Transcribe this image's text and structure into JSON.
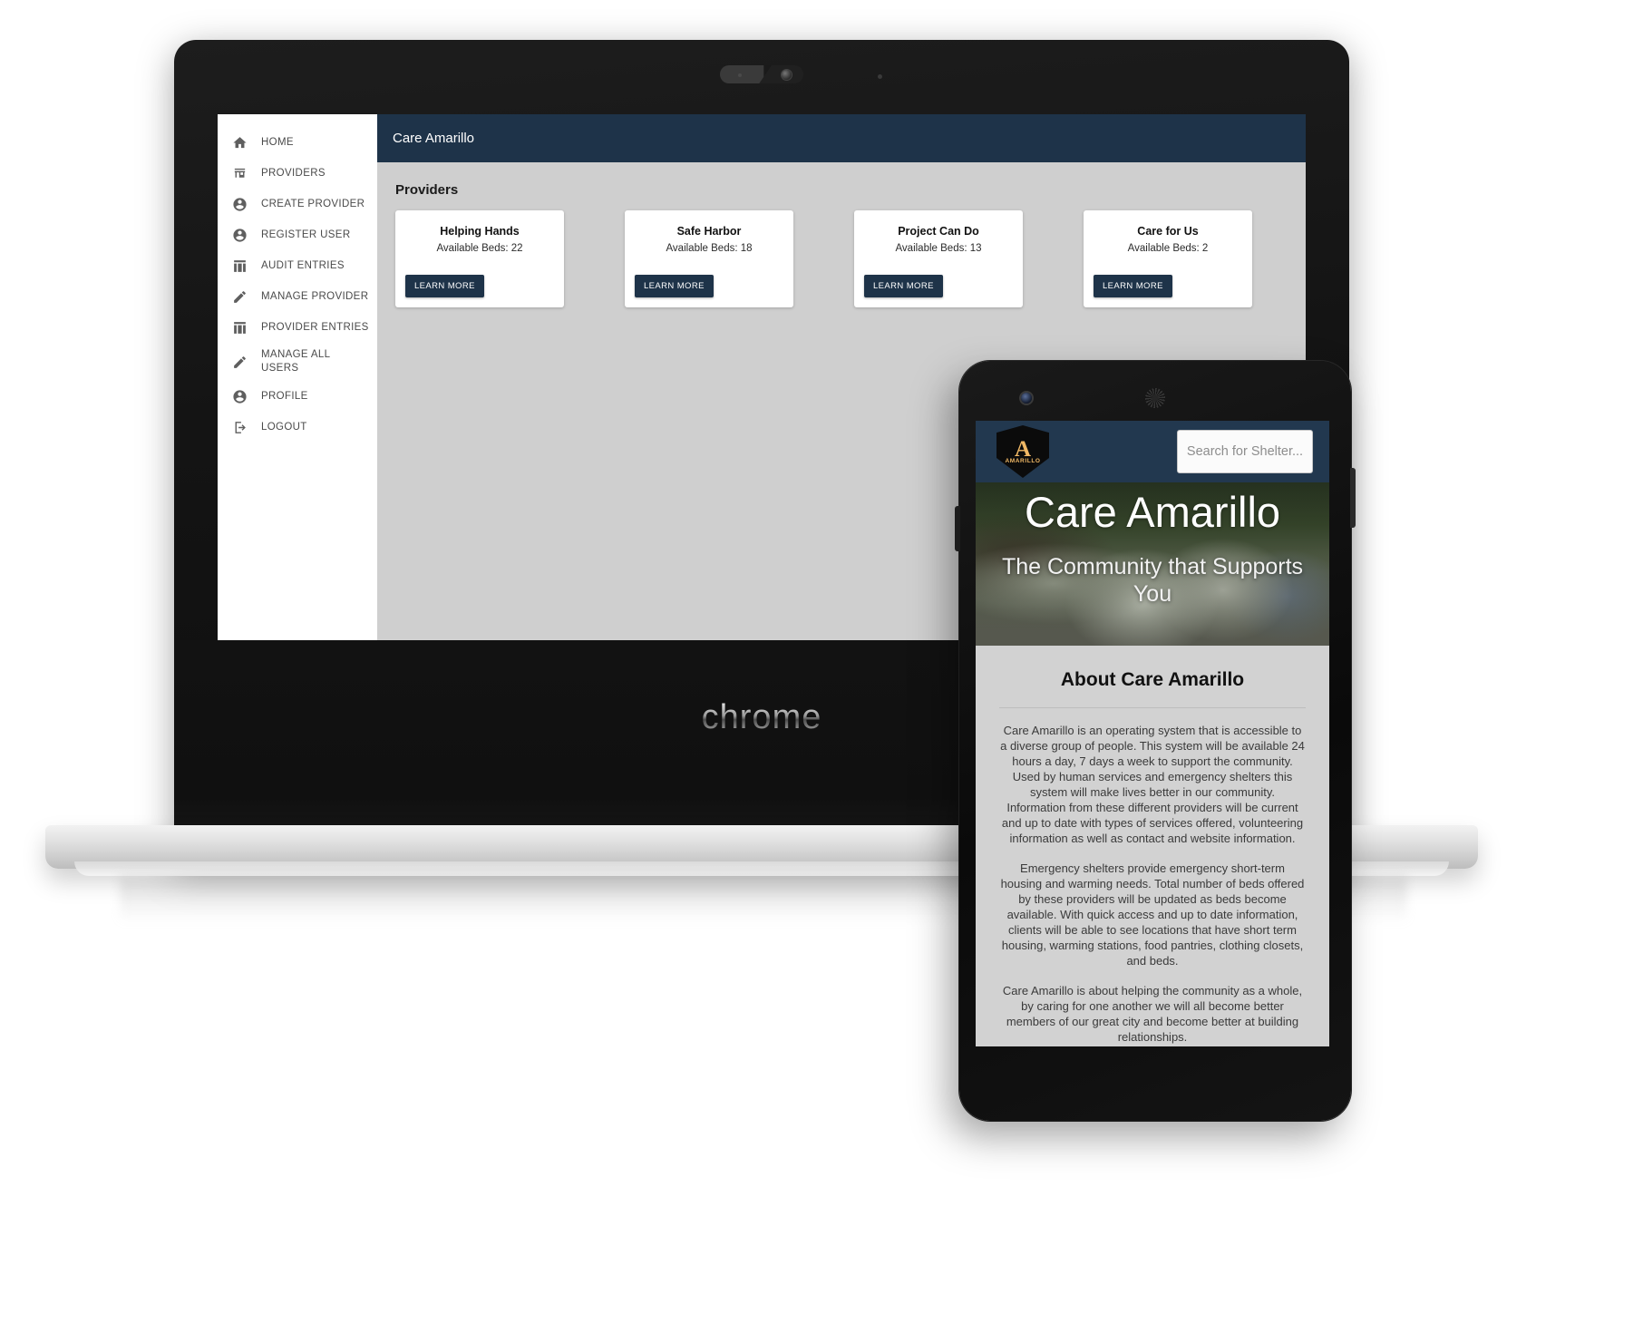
{
  "laptop": {
    "brand_label": "chrome",
    "app": {
      "topbar_title": "Care Amarillo",
      "section_title": "Providers",
      "sidebar_items": [
        {
          "label": "HOME",
          "icon": "home-icon"
        },
        {
          "label": "PROVIDERS",
          "icon": "store-icon"
        },
        {
          "label": "CREATE PROVIDER",
          "icon": "account-circle-icon"
        },
        {
          "label": "REGISTER USER",
          "icon": "account-circle-icon"
        },
        {
          "label": "AUDIT ENTRIES",
          "icon": "table-icon"
        },
        {
          "label": "MANAGE PROVIDER",
          "icon": "pencil-icon"
        },
        {
          "label": "PROVIDER ENTRIES",
          "icon": "table-icon"
        },
        {
          "label": "MANAGE ALL USERS",
          "icon": "pencil-icon"
        },
        {
          "label": "PROFILE",
          "icon": "account-circle-icon"
        },
        {
          "label": "LOGOUT",
          "icon": "logout-icon"
        }
      ],
      "cards": [
        {
          "title": "Helping Hands",
          "beds_label": "Available Beds: 22",
          "button": "LEARN MORE"
        },
        {
          "title": "Safe Harbor",
          "beds_label": "Available Beds: 18",
          "button": "LEARN MORE"
        },
        {
          "title": "Project Can Do",
          "beds_label": "Available Beds: 13",
          "button": "LEARN MORE"
        },
        {
          "title": "Care for Us",
          "beds_label": "Available Beds: 2",
          "button": "LEARN MORE"
        }
      ]
    }
  },
  "phone": {
    "nav": {
      "logo_letter": "A",
      "logo_word": "AMARILLO",
      "search_placeholder": "Search for Shelter..."
    },
    "hero": {
      "title": "Care Amarillo",
      "subtitle": "The Community that Supports You"
    },
    "about": {
      "heading": "About Care Amarillo",
      "paragraphs": [
        "Care Amarillo is an operating system that is accessible to a diverse group of people. This system will be available 24 hours a day, 7 days a week to support the community. Used by human services and emergency shelters this system will make lives better in our community. Information from these different providers will be current and up to date with types of services offered, volunteering information as well as contact and website information.",
        "Emergency shelters provide emergency short-term housing and warming needs. Total number of beds offered by these providers will be updated as beds become available. With quick access and up to date information, clients will be able to see locations that have short term housing, warming stations, food pantries, clothing closets, and beds.",
        "Care Amarillo is about helping the community as a whole, by caring for one another we will all become better members of our great city and become better at building relationships."
      ]
    }
  },
  "colors": {
    "navy": "#1e3349",
    "phone_navy": "#22384f",
    "app_bg": "#cfcfcf",
    "logo_gold": "#f0b865"
  }
}
